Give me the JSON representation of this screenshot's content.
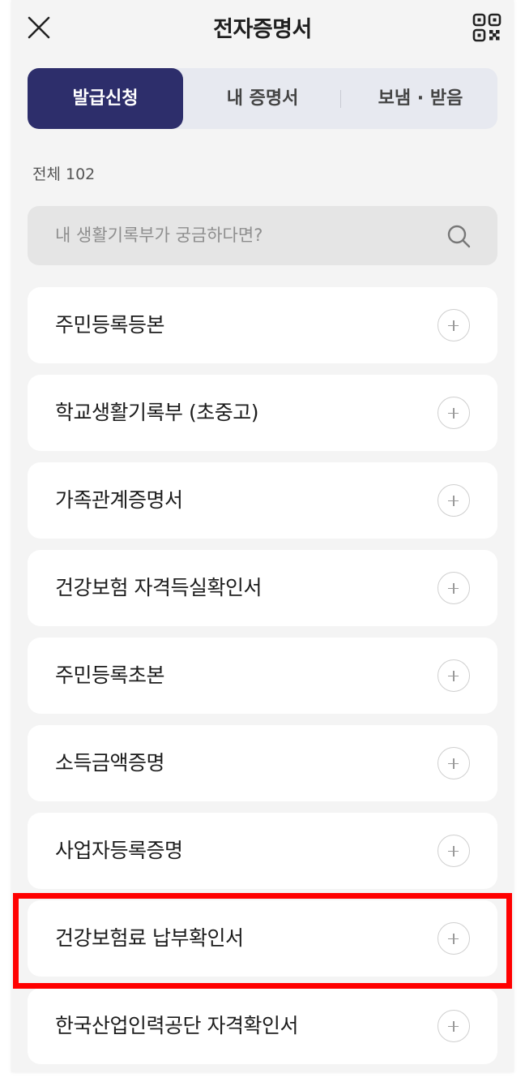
{
  "header": {
    "title": "전자증명서",
    "close_icon": "close-icon",
    "qr_icon": "qr-code-icon"
  },
  "tabs": [
    {
      "label": "발급신청",
      "active": true
    },
    {
      "label": "내 증명서",
      "active": false
    },
    {
      "label": "보냄 · 받음",
      "active": false
    }
  ],
  "count_label": "전체 102",
  "search": {
    "placeholder": "내 생활기록부가 궁금하다면?",
    "icon": "search-icon"
  },
  "documents": [
    {
      "label": "주민등록등본"
    },
    {
      "label": "학교생활기록부 (초중고)"
    },
    {
      "label": "가족관계증명서"
    },
    {
      "label": "건강보험 자격득실확인서"
    },
    {
      "label": "주민등록초본"
    },
    {
      "label": "소득금액증명"
    },
    {
      "label": "사업자등록증명"
    },
    {
      "label": "건강보험료 납부확인서",
      "highlighted": true
    },
    {
      "label": "한국산업인력공단 자격확인서"
    }
  ],
  "colors": {
    "accent": "#2d2e6b",
    "highlight": "#ff0000",
    "background": "#f4f4f4"
  }
}
